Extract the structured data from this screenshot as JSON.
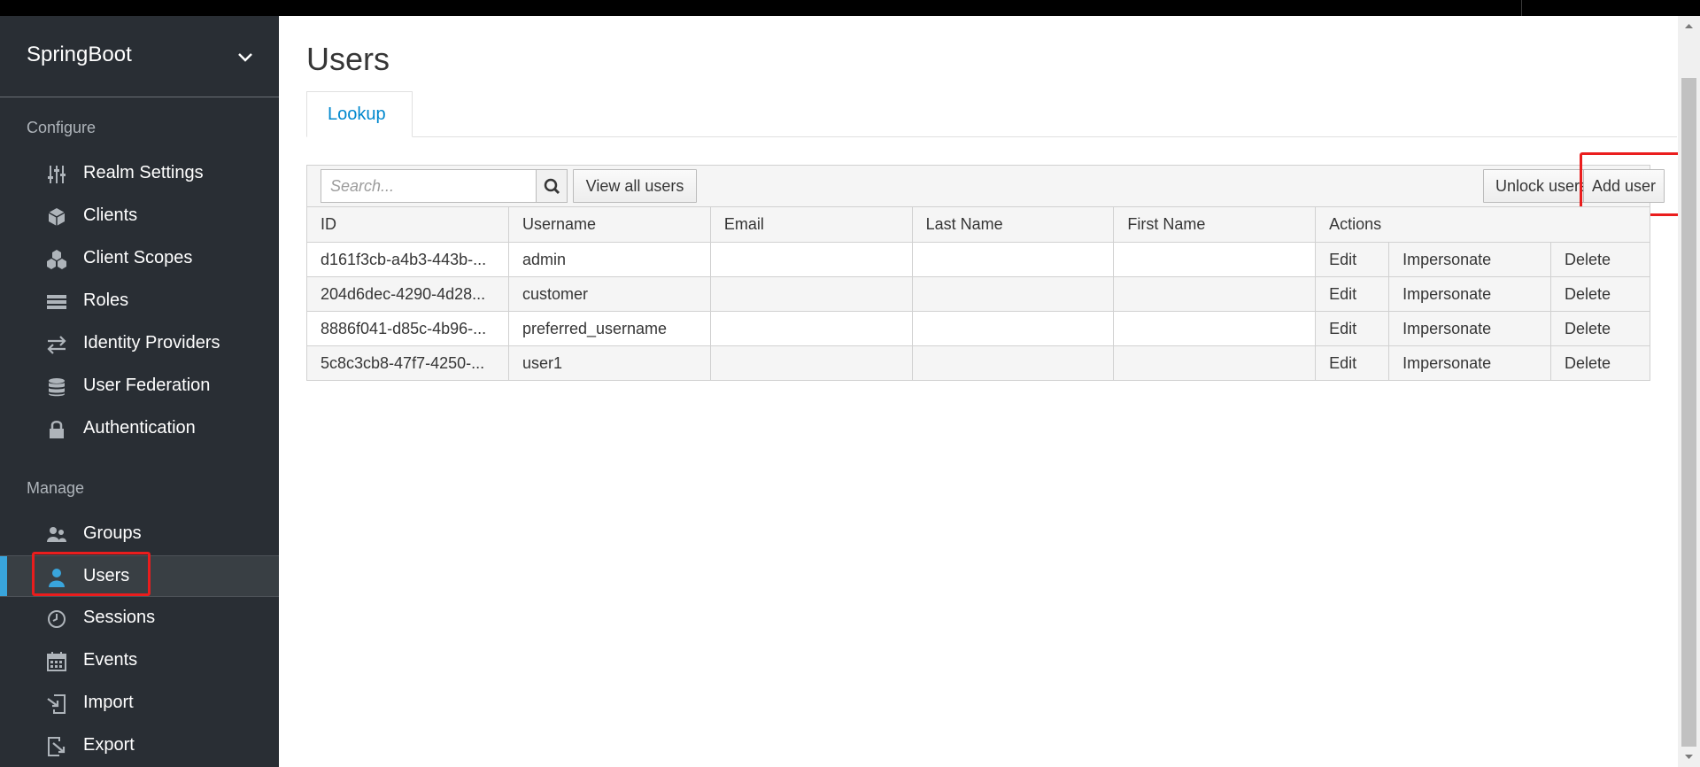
{
  "realm": {
    "name": "SpringBoot"
  },
  "sidebar": {
    "configure_title": "Configure",
    "configure_items": [
      {
        "label": "Realm Settings",
        "icon": "sliders-icon"
      },
      {
        "label": "Clients",
        "icon": "cube-icon"
      },
      {
        "label": "Client Scopes",
        "icon": "cubes-icon"
      },
      {
        "label": "Roles",
        "icon": "list-icon"
      },
      {
        "label": "Identity Providers",
        "icon": "exchange-icon"
      },
      {
        "label": "User Federation",
        "icon": "database-icon"
      },
      {
        "label": "Authentication",
        "icon": "lock-icon"
      }
    ],
    "manage_title": "Manage",
    "manage_items": [
      {
        "label": "Groups",
        "icon": "users-icon"
      },
      {
        "label": "Users",
        "icon": "user-icon",
        "active": true
      },
      {
        "label": "Sessions",
        "icon": "clock-icon"
      },
      {
        "label": "Events",
        "icon": "calendar-icon"
      },
      {
        "label": "Import",
        "icon": "import-icon"
      },
      {
        "label": "Export",
        "icon": "export-icon"
      }
    ]
  },
  "main": {
    "title": "Users",
    "tabs": [
      {
        "label": "Lookup"
      }
    ],
    "toolbar": {
      "search_placeholder": "Search...",
      "view_all_label": "View all users",
      "unlock_label": "Unlock users",
      "add_user_label": "Add user"
    },
    "table": {
      "columns": [
        "ID",
        "Username",
        "Email",
        "Last Name",
        "First Name",
        "Actions"
      ],
      "rows": [
        {
          "id": "d161f3cb-a4b3-443b-...",
          "username": "admin",
          "email": "",
          "last_name": "",
          "first_name": ""
        },
        {
          "id": "204d6dec-4290-4d28...",
          "username": "customer",
          "email": "",
          "last_name": "",
          "first_name": ""
        },
        {
          "id": "8886f041-d85c-4b96-...",
          "username": "preferred_username",
          "email": "",
          "last_name": "",
          "first_name": ""
        },
        {
          "id": "5c8c3cb8-47f7-4250-...",
          "username": "user1",
          "email": "",
          "last_name": "",
          "first_name": ""
        }
      ],
      "actions": {
        "edit": "Edit",
        "impersonate": "Impersonate",
        "delete": "Delete"
      }
    }
  },
  "colors": {
    "sidebar_bg": "#292e34",
    "accent": "#0088ce",
    "active_bar": "#39a5dc",
    "highlight": "#ea1d1d"
  }
}
